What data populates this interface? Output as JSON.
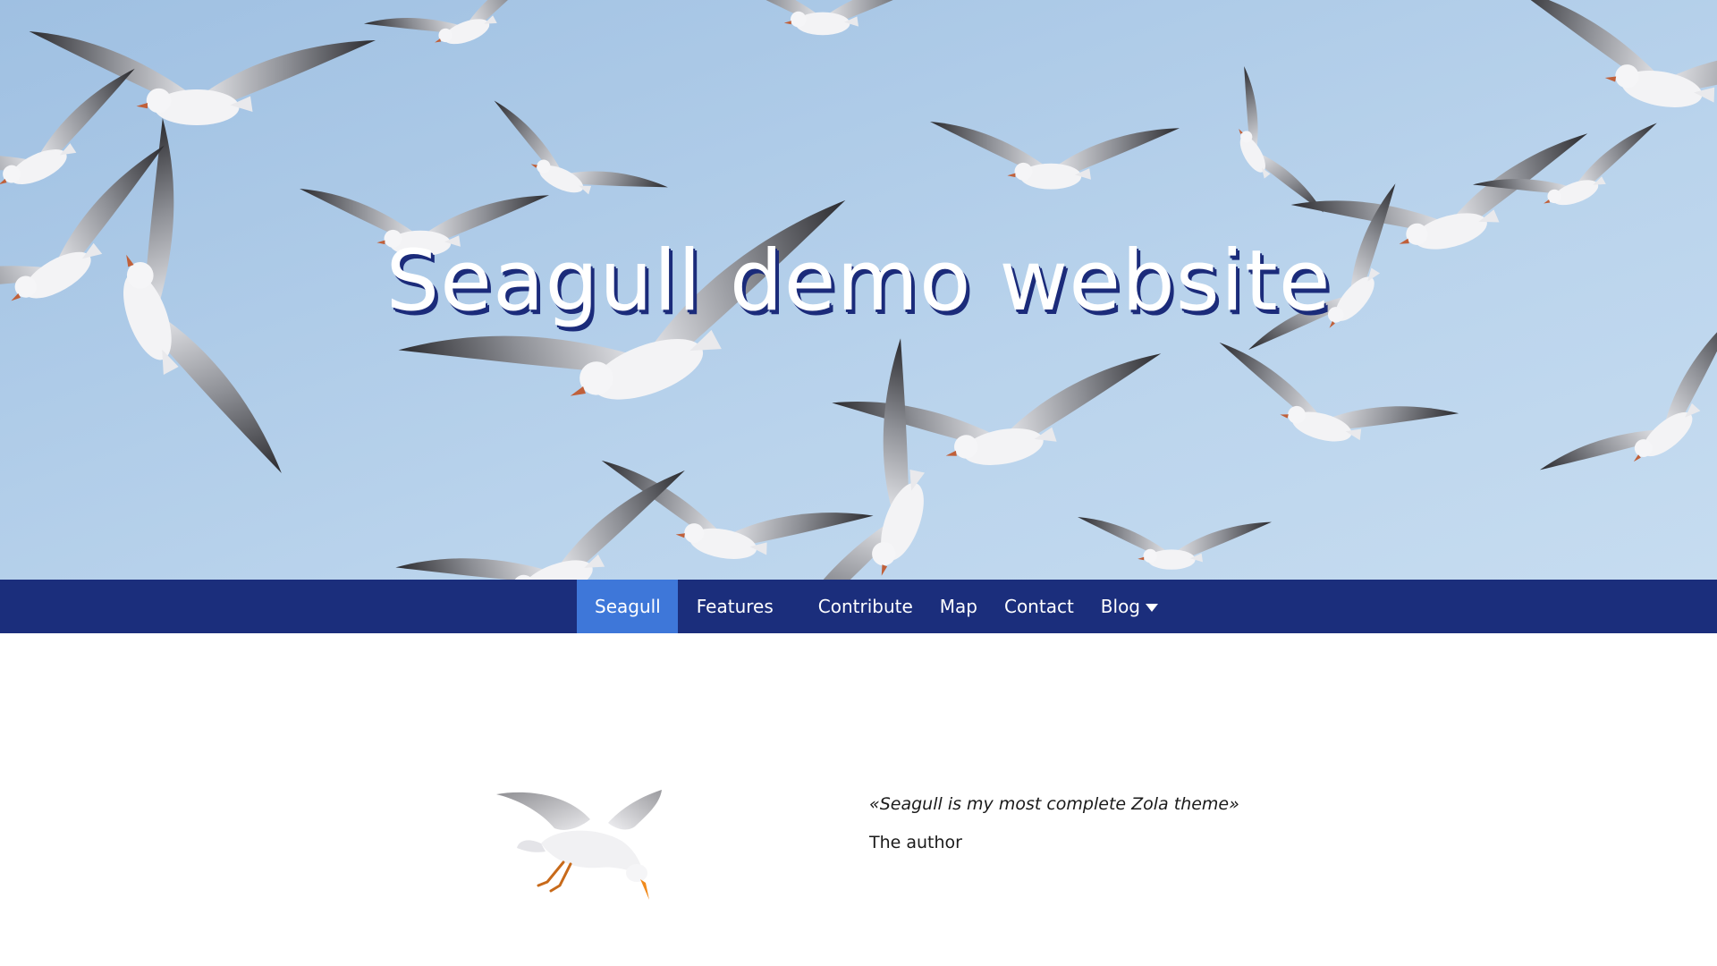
{
  "hero": {
    "title": "Seagull demo website",
    "image_subject": "seagulls flying against a blue sky"
  },
  "navbar": {
    "items": [
      {
        "label": "Seagull",
        "active": true
      },
      {
        "label": "Features",
        "active": false
      },
      {
        "label": "Contribute",
        "active": false
      },
      {
        "label": "Map",
        "active": false
      },
      {
        "label": "Contact",
        "active": false
      },
      {
        "label": "Blog",
        "active": false,
        "dropdown": true
      }
    ]
  },
  "content": {
    "quote": "«Seagull is my most complete Zola theme»",
    "author": "The author"
  },
  "colors": {
    "navbar_bg": "#1b2e7c",
    "nav_active_bg": "#3e77d9",
    "title_shadow": "#1b2b7a",
    "sky": "#b8d2ec"
  },
  "icons": {
    "blog_dropdown": "caret-down-icon",
    "logo": "seagull-illustration"
  }
}
